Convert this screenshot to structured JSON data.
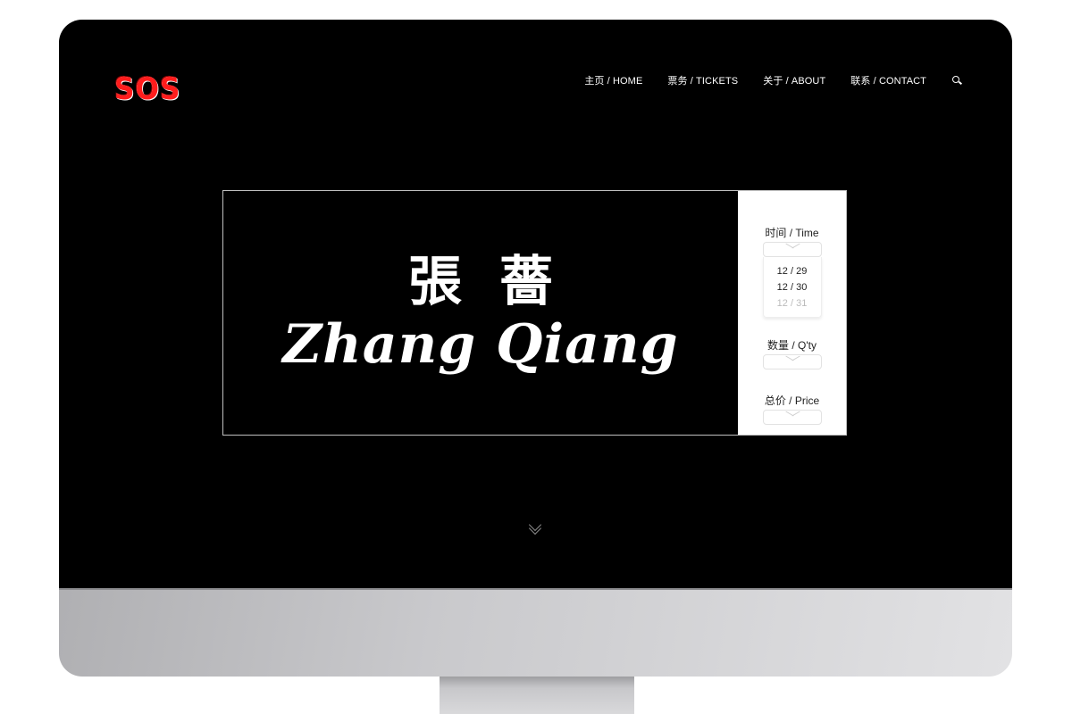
{
  "logo": {
    "text": "SOS",
    "color": "#ff1c1c"
  },
  "nav": {
    "items": [
      {
        "label": "主页 / HOME"
      },
      {
        "label": "票务 / TICKETS"
      },
      {
        "label": "关于 / ABOUT"
      },
      {
        "label": "联系 / CONTACT"
      }
    ],
    "search_icon": "search-icon"
  },
  "banner": {
    "title_cn": "張薔",
    "title_en": "Zhang Qiang"
  },
  "ticket_panel": {
    "time_label": "时间 / Time",
    "time_options": [
      "12 / 29",
      "12 / 30",
      "12 / 31"
    ],
    "qty_label": "数量 / Q'ty",
    "price_label": "总价 / Price"
  },
  "scroll_icon": "double-chevron-down-icon",
  "colors": {
    "screen": "#000000",
    "panel": "#ffffff",
    "accent": "#ff1c1c"
  }
}
